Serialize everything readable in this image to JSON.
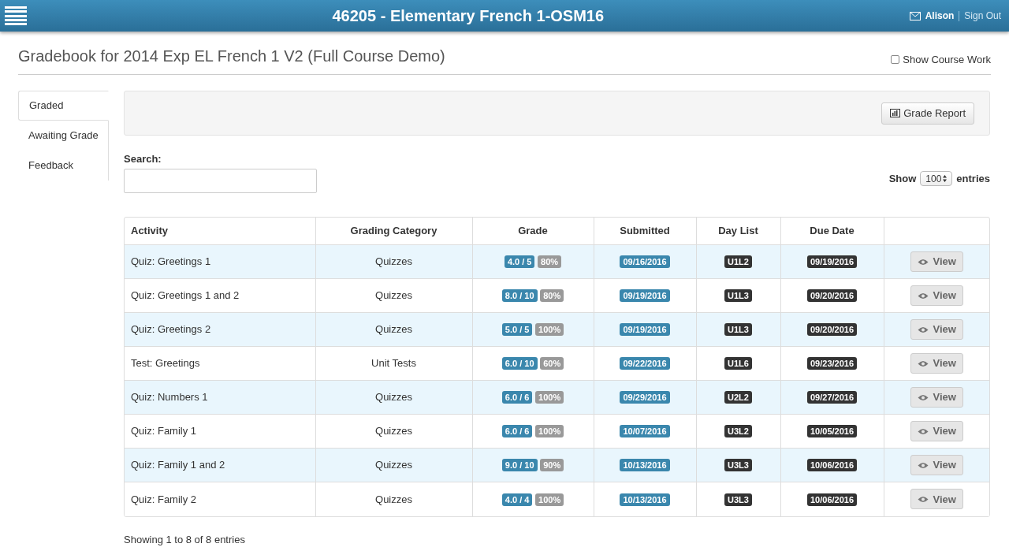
{
  "header": {
    "title": "46205 - Elementary French 1-OSM16",
    "user": "Alison",
    "sign_out": "Sign Out"
  },
  "page_title": "Gradebook for 2014 Exp EL French 1 V2 (Full Course Demo)",
  "show_course_work": {
    "label": "Show Course Work",
    "checked": false
  },
  "tabs": [
    {
      "label": "Graded",
      "selected": true
    },
    {
      "label": "Awaiting Grade",
      "selected": false
    },
    {
      "label": "Feedback",
      "selected": false
    }
  ],
  "grade_report_button": "Grade Report",
  "search": {
    "label": "Search:"
  },
  "page_size": {
    "prefix": "Show",
    "value": "100",
    "suffix": "entries"
  },
  "table": {
    "columns": [
      "Activity",
      "Grading Category",
      "Grade",
      "Submitted",
      "Day List",
      "Due Date"
    ],
    "rows": [
      {
        "activity": "Quiz: Greetings 1",
        "category": "Quizzes",
        "score": "4.0 / 5",
        "percent": "80%",
        "submitted": "09/16/2016",
        "day_list": "U1L2",
        "due_date": "09/19/2016",
        "action": "View"
      },
      {
        "activity": "Quiz: Greetings 1 and 2",
        "category": "Quizzes",
        "score": "8.0 / 10",
        "percent": "80%",
        "submitted": "09/19/2016",
        "day_list": "U1L3",
        "due_date": "09/20/2016",
        "action": "View"
      },
      {
        "activity": "Quiz: Greetings 2",
        "category": "Quizzes",
        "score": "5.0 / 5",
        "percent": "100%",
        "submitted": "09/19/2016",
        "day_list": "U1L3",
        "due_date": "09/20/2016",
        "action": "View"
      },
      {
        "activity": "Test: Greetings",
        "category": "Unit Tests",
        "score": "6.0 / 10",
        "percent": "60%",
        "submitted": "09/22/2016",
        "day_list": "U1L6",
        "due_date": "09/23/2016",
        "action": "View"
      },
      {
        "activity": "Quiz: Numbers 1",
        "category": "Quizzes",
        "score": "6.0 / 6",
        "percent": "100%",
        "submitted": "09/29/2016",
        "day_list": "U2L2",
        "due_date": "09/27/2016",
        "action": "View"
      },
      {
        "activity": "Quiz: Family 1",
        "category": "Quizzes",
        "score": "6.0 / 6",
        "percent": "100%",
        "submitted": "10/07/2016",
        "day_list": "U3L2",
        "due_date": "10/05/2016",
        "action": "View"
      },
      {
        "activity": "Quiz: Family 1 and 2",
        "category": "Quizzes",
        "score": "9.0 / 10",
        "percent": "90%",
        "submitted": "10/13/2016",
        "day_list": "U3L3",
        "due_date": "10/06/2016",
        "action": "View"
      },
      {
        "activity": "Quiz: Family 2",
        "category": "Quizzes",
        "score": "4.0 / 4",
        "percent": "100%",
        "submitted": "10/13/2016",
        "day_list": "U3L3",
        "due_date": "10/06/2016",
        "action": "View"
      }
    ]
  },
  "info": "Showing 1 to 8 of 8 entries"
}
